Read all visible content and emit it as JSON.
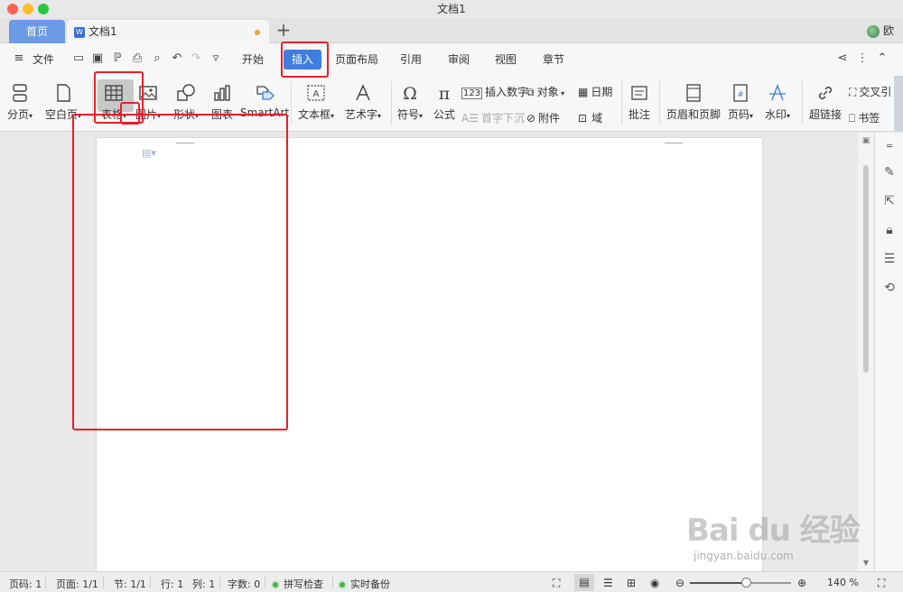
{
  "window": {
    "title": "文档1"
  },
  "tabs": {
    "home": "首页",
    "doc": "文档1",
    "add": "+"
  },
  "user": {
    "name": "欧"
  },
  "menu": {
    "hamburger_label": "文件",
    "items": [
      "开始",
      "插入",
      "页面布局",
      "引用",
      "审阅",
      "视图",
      "章节"
    ],
    "active": "插入"
  },
  "ribbon": {
    "pagebreak": "分页",
    "blankpage": "空白页",
    "table": "表格",
    "picture": "图片",
    "shape": "形状",
    "chart": "图表",
    "smartart": "SmartArt",
    "textbox": "文本框",
    "arttext": "艺术字",
    "symbol": "符号",
    "formula": "公式",
    "insert_number": "插入数字",
    "object": "对象",
    "date": "日期",
    "dropcap": "首字下沉",
    "attachment": "附件",
    "field": "域",
    "comment": "批注",
    "header_footer": "页眉和页脚",
    "page_number": "页码",
    "watermark": "水印",
    "hyperlink": "超链接",
    "crossref": "交叉引",
    "bookmark": "书签"
  },
  "status": {
    "page": "页码: 1",
    "pages": "页面: 1/1",
    "section": "节: 1/1",
    "row": "行: 1",
    "col": "列: 1",
    "words": "字数: 0",
    "spellcheck": "拼写检查",
    "backup": "实时备份",
    "zoom": "140 %",
    "zoom_level": 0.55
  },
  "watermark": {
    "brand": "Bai du 经验",
    "url": "jingyan.baidu.com"
  },
  "colors": {
    "accent": "#3e7ee0",
    "home_tab": "#6b9be6",
    "annotation": "#e8202a"
  }
}
